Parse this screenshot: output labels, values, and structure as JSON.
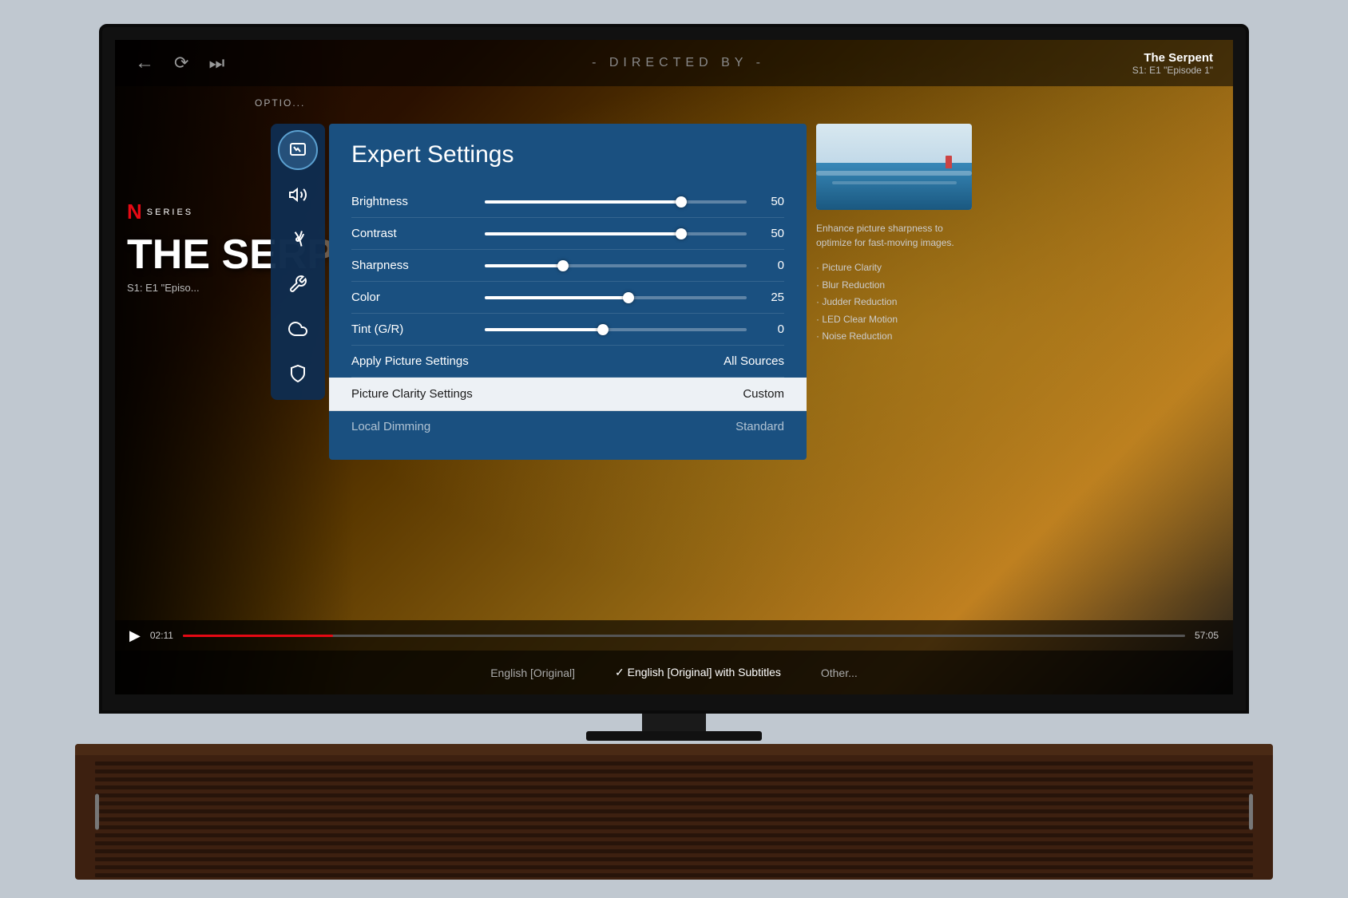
{
  "tv": {
    "show": {
      "name": "The Serpent",
      "season_episode": "S1: E1 \"Episode 1\""
    },
    "top_bar": {
      "text": "- DIRECTED BY -"
    },
    "bottom_bar": {
      "items": [
        {
          "label": "English [Original]",
          "active": false
        },
        {
          "label": "English [Original] with Subtitles",
          "active": true,
          "checkmark": true
        },
        {
          "label": "Other...",
          "active": false
        }
      ]
    },
    "progress": {
      "current": "02:11",
      "total": "57:05"
    }
  },
  "netflix": {
    "series_label": "SERIES",
    "show_title": "THE SE",
    "episode_label": "S1: E1 \"Episo..."
  },
  "options_label": "OPTIO...",
  "settings_panel": {
    "title": "Expert Settings",
    "settings": [
      {
        "label": "Brightness",
        "type": "slider",
        "value": 50,
        "percent": 75
      },
      {
        "label": "Contrast",
        "type": "slider",
        "value": 50,
        "percent": 75
      },
      {
        "label": "Sharpness",
        "type": "slider",
        "value": 0,
        "percent": 30
      },
      {
        "label": "Color",
        "type": "slider",
        "value": 25,
        "percent": 55
      },
      {
        "label": "Tint (G/R)",
        "type": "slider",
        "value": 0,
        "percent": 45
      },
      {
        "label": "Apply Picture Settings",
        "type": "text",
        "value": "All Sources"
      },
      {
        "label": "Picture Clarity Settings",
        "type": "text",
        "value": "Custom",
        "highlighted": true
      },
      {
        "label": "Local Dimming",
        "type": "text",
        "value": "Standard",
        "partial": true
      }
    ]
  },
  "info_panel": {
    "description": "Enhance picture sharpness to optimize for fast-moving images.",
    "features": [
      "Picture Clarity",
      "Blur Reduction",
      "Judder Reduction",
      "LED Clear Motion",
      "Noise Reduction"
    ]
  },
  "sidebar_icons": [
    {
      "name": "picture-icon",
      "symbol": "🖼",
      "active": true
    },
    {
      "name": "sound-icon",
      "symbol": "🔊",
      "active": false
    },
    {
      "name": "broadcast-icon",
      "symbol": "📡",
      "active": false
    },
    {
      "name": "tools-icon",
      "symbol": "🔧",
      "active": false
    },
    {
      "name": "cloud-icon",
      "symbol": "☁",
      "active": false
    },
    {
      "name": "shield-icon",
      "symbol": "🛡",
      "active": false
    }
  ],
  "colors": {
    "panel_bg": "#1a5080",
    "sidebar_bg": "rgba(20,60,100,0.95)",
    "highlighted_bg": "rgba(255,255,255,0.9)",
    "netflix_red": "#e50914"
  }
}
